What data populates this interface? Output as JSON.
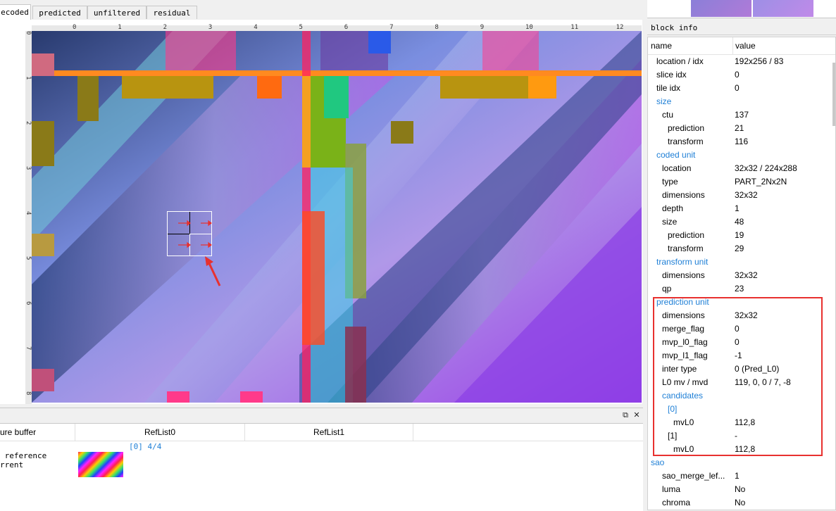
{
  "tabs": [
    {
      "label": "ecoded",
      "active": true
    },
    {
      "label": "predicted",
      "active": false
    },
    {
      "label": "unfiltered",
      "active": false
    },
    {
      "label": "residual",
      "active": false
    }
  ],
  "ruler": {
    "top": [
      "0",
      "1",
      "2",
      "3",
      "4",
      "5",
      "6",
      "7",
      "8",
      "9",
      "10",
      "11",
      "12"
    ],
    "left": [
      "0",
      "1",
      "2",
      "3",
      "4",
      "5",
      "6",
      "7",
      "8"
    ]
  },
  "bottom_panel": {
    "float_icon": "⧉",
    "close_icon": "✕",
    "col_buffer": "ure buffer",
    "col_reflist0": "RefList0",
    "col_reflist1": "RefList1",
    "ref_entry": "[0] 4/4",
    "reference_label": " reference",
    "current_label": "rrent"
  },
  "block_info": {
    "title": "block info",
    "col_name": "name",
    "col_value": "value",
    "rows": [
      {
        "name": "location / idx",
        "value": "192x256 / 83",
        "level": 1,
        "section": false
      },
      {
        "name": "slice idx",
        "value": "0",
        "level": 1,
        "section": false
      },
      {
        "name": "tile idx",
        "value": "0",
        "level": 1,
        "section": false
      },
      {
        "name": "size",
        "value": "",
        "level": 1,
        "section": true
      },
      {
        "name": "ctu",
        "value": "137",
        "level": 2,
        "section": false
      },
      {
        "name": "prediction",
        "value": "21",
        "level": 3,
        "section": false
      },
      {
        "name": "transform",
        "value": "116",
        "level": 3,
        "section": false
      },
      {
        "name": "coded unit",
        "value": "",
        "level": 1,
        "section": true
      },
      {
        "name": "location",
        "value": "32x32 / 224x288",
        "level": 2,
        "section": false
      },
      {
        "name": "type",
        "value": "PART_2Nx2N",
        "level": 2,
        "section": false
      },
      {
        "name": "dimensions",
        "value": "32x32",
        "level": 2,
        "section": false
      },
      {
        "name": "depth",
        "value": "1",
        "level": 2,
        "section": false
      },
      {
        "name": "size",
        "value": "48",
        "level": 2,
        "section": false
      },
      {
        "name": "prediction",
        "value": "19",
        "level": 3,
        "section": false
      },
      {
        "name": "transform",
        "value": "29",
        "level": 3,
        "section": false
      },
      {
        "name": "transform unit",
        "value": "",
        "level": 1,
        "section": true
      },
      {
        "name": "dimensions",
        "value": "32x32",
        "level": 2,
        "section": false
      },
      {
        "name": "qp",
        "value": "23",
        "level": 2,
        "section": false
      },
      {
        "name": "prediction unit",
        "value": "",
        "level": 1,
        "section": true
      },
      {
        "name": "dimensions",
        "value": "32x32",
        "level": 2,
        "section": false
      },
      {
        "name": "merge_flag",
        "value": "0",
        "level": 2,
        "section": false
      },
      {
        "name": "mvp_l0_flag",
        "value": "0",
        "level": 2,
        "section": false
      },
      {
        "name": "mvp_l1_flag",
        "value": "-1",
        "level": 2,
        "section": false
      },
      {
        "name": "inter type",
        "value": "0 (Pred_L0)",
        "level": 2,
        "section": false
      },
      {
        "name": "L0 mv / mvd",
        "value": "119, 0, 0 / 7, -8",
        "level": 2,
        "section": false
      },
      {
        "name": "candidates",
        "value": "",
        "level": 2,
        "section": true
      },
      {
        "name": "[0]",
        "value": "",
        "level": 3,
        "section": true
      },
      {
        "name": "mvL0",
        "value": "112,8",
        "level": 4,
        "section": false
      },
      {
        "name": "[1]",
        "value": "-",
        "level": 3,
        "section": false
      },
      {
        "name": "mvL0",
        "value": "112,8",
        "level": 4,
        "section": false
      },
      {
        "name": "sao",
        "value": "",
        "level": 0,
        "section": true
      },
      {
        "name": "sao_merge_lef...",
        "value": "1",
        "level": 2,
        "section": false
      },
      {
        "name": "luma",
        "value": "No",
        "level": 2,
        "section": false
      },
      {
        "name": "chroma",
        "value": "No",
        "level": 2,
        "section": false
      }
    ]
  },
  "colors": {
    "highlight": "#e8312f",
    "tree_section": "#1e7fd6",
    "arrow": "#e8312f"
  }
}
